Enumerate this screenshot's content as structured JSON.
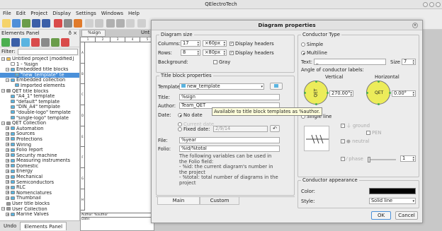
{
  "app": {
    "title": "QElectroTech"
  },
  "menu": [
    "File",
    "Edit",
    "Project",
    "Display",
    "Settings",
    "Windows",
    "Help"
  ],
  "panel": {
    "title": "Elements Panel",
    "filter_label": "Filter:",
    "tree": [
      {
        "label": "Untitled project [modified]",
        "indent": 0,
        "exp": "-",
        "icon": "#f0c050"
      },
      {
        "label": "1 - %sign",
        "indent": 1,
        "exp": "",
        "icon": "#ffffff"
      },
      {
        "label": "Embedded title blocks",
        "indent": 1,
        "exp": "-",
        "icon": "#5ab4e0"
      },
      {
        "label": "\"new_template\" te",
        "indent": 2,
        "exp": "",
        "icon": "#5ab4e0",
        "selected": true
      },
      {
        "label": "Embedded collection",
        "indent": 1,
        "exp": "-",
        "icon": "#5ab4e0"
      },
      {
        "label": "Imported elements",
        "indent": 2,
        "exp": "",
        "icon": "#5ab4e0"
      },
      {
        "label": "QET title blocks",
        "indent": 0,
        "exp": "-",
        "icon": "#999999"
      },
      {
        "label": "\"A4_1\" template",
        "indent": 1,
        "exp": "",
        "icon": "#5ab4e0"
      },
      {
        "label": "\"default\" template",
        "indent": 1,
        "exp": "",
        "icon": "#5ab4e0"
      },
      {
        "label": "\"DIN_A4\" template",
        "indent": 1,
        "exp": "",
        "icon": "#5ab4e0"
      },
      {
        "label": "\"double-logo\" template",
        "indent": 1,
        "exp": "",
        "icon": "#5ab4e0"
      },
      {
        "label": "\"single-logo\" template",
        "indent": 1,
        "exp": "",
        "icon": "#5ab4e0"
      },
      {
        "label": "QET Collection",
        "indent": 0,
        "exp": "-",
        "icon": "#999999"
      },
      {
        "label": "Automation",
        "indent": 1,
        "exp": "+",
        "icon": "#5ab4e0"
      },
      {
        "label": "Sources",
        "indent": 1,
        "exp": "+",
        "icon": "#5ab4e0"
      },
      {
        "label": "Protections",
        "indent": 1,
        "exp": "+",
        "icon": "#5ab4e0"
      },
      {
        "label": "Wiring",
        "indent": 1,
        "exp": "+",
        "icon": "#5ab4e0"
      },
      {
        "label": "Folio report",
        "indent": 1,
        "exp": "+",
        "icon": "#5ab4e0"
      },
      {
        "label": "Security machine",
        "indent": 1,
        "exp": "+",
        "icon": "#5ab4e0"
      },
      {
        "label": "Measuring instruments",
        "indent": 1,
        "exp": "+",
        "icon": "#5ab4e0"
      },
      {
        "label": "Domestic",
        "indent": 1,
        "exp": "+",
        "icon": "#5ab4e0"
      },
      {
        "label": "Energy",
        "indent": 1,
        "exp": "+",
        "icon": "#5ab4e0"
      },
      {
        "label": "Mechanical",
        "indent": 1,
        "exp": "+",
        "icon": "#5ab4e0"
      },
      {
        "label": "Semiconductors",
        "indent": 1,
        "exp": "+",
        "icon": "#5ab4e0"
      },
      {
        "label": "RLC",
        "indent": 1,
        "exp": "+",
        "icon": "#5ab4e0"
      },
      {
        "label": "Nomenclatures",
        "indent": 1,
        "exp": "+",
        "icon": "#5ab4e0"
      },
      {
        "label": "Thumbnail",
        "indent": 1,
        "exp": "+",
        "icon": "#5ab4e0"
      },
      {
        "label": "User title blocks",
        "indent": 0,
        "exp": "",
        "icon": "#999999"
      },
      {
        "label": "User Collection",
        "indent": 0,
        "exp": "-",
        "icon": "#999999"
      },
      {
        "label": "Marine Valves",
        "indent": 1,
        "exp": "+",
        "icon": "#5ab4e0"
      }
    ],
    "bottom_tabs": [
      "Undo",
      "Elements Panel"
    ]
  },
  "workspace": {
    "tab_label": "%sign",
    "ruler_cols": [
      "1",
      "2",
      "3",
      "4",
      "5"
    ],
    "ruler_rows": [
      "A",
      "B",
      "C",
      "D",
      "E",
      "F",
      "G",
      "H"
    ],
    "tblock_author": "Author: %author",
    "tblock_date": "Date:",
    "partial_tab": "Unt"
  },
  "dialog": {
    "title": "Diagram properties",
    "size": {
      "group": "Diagram size",
      "columns_label": "Columns:",
      "columns_value": "17",
      "col_width": "×60px",
      "col_headers": "Display headers",
      "rows_label": "Rows:",
      "rows_value": "8",
      "row_height": "×80px",
      "row_headers": "Display headers",
      "background_label": "Background:",
      "gray_label": "Gray"
    },
    "tb": {
      "group": "Title block properties",
      "template_label": "Template:",
      "template_value": "new_template",
      "title_label": "Title:",
      "title_value": "%sign",
      "author_label": "Author:",
      "author_value": "Team_QET",
      "date_label": "Date:",
      "no_date": "No date",
      "current_date": "Current date",
      "fixed_date": "Fixed date:",
      "fixed_date_value": "2/9/14",
      "file_label": "File:",
      "file_value": "%year",
      "folio_label": "Folio:",
      "folio_value": "%id/%total",
      "help_line1": "The following variables can be used in the Folio field:",
      "help_line2": "- %id: the current diagram's number in the project",
      "help_line3": "- %total: total number of diagrams in the project",
      "tab_main": "Main",
      "tab_custom": "Custom"
    },
    "tooltip": "Available to title block templates as %author.",
    "conductor": {
      "group": "Conductor Type",
      "simple": "Simple",
      "multiline": "Multiline",
      "text_label": "Text:",
      "text_value": "_",
      "size_label": "Size",
      "size_value": "7",
      "angle_label": "Angle of conductor labels:",
      "vertical": "Vertical",
      "horizontal": "Horizontal",
      "vertical_value": "270.00°",
      "horizontal_value": "0.00°",
      "qet_text": "QET",
      "single_line": "Single line",
      "ground": "ground",
      "pen": "PEN",
      "neutral": "neutral",
      "phase": "phase",
      "phase_value": "1"
    },
    "appearance": {
      "group": "Conductor appearance",
      "color_label": "Color:",
      "color_value": "#000000",
      "style_label": "Style:",
      "style_value": "Solid line"
    },
    "ok": "OK",
    "cancel": "Cancel"
  }
}
